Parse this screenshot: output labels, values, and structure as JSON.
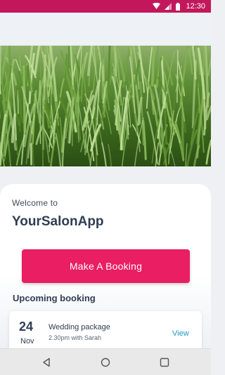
{
  "status_bar": {
    "time": "12:30",
    "icons": [
      "wifi-icon",
      "signal-icon",
      "battery-icon"
    ],
    "color": "#c2185b"
  },
  "hero": {
    "image": "grass-photo"
  },
  "welcome": {
    "greeting": "Welcome to",
    "app_name": "YourSalonApp"
  },
  "actions": {
    "make_booking_label": "Make A Booking",
    "accent_color": "#e91e63"
  },
  "upcoming": {
    "title": "Upcoming booking",
    "bookings": [
      {
        "day": "24",
        "month": "Nov",
        "service": "Wedding package",
        "time": "2.30pm with Sarah",
        "action": "View"
      }
    ]
  },
  "nav_bar": {
    "icons": [
      "back-icon",
      "home-icon",
      "recents-icon"
    ]
  }
}
